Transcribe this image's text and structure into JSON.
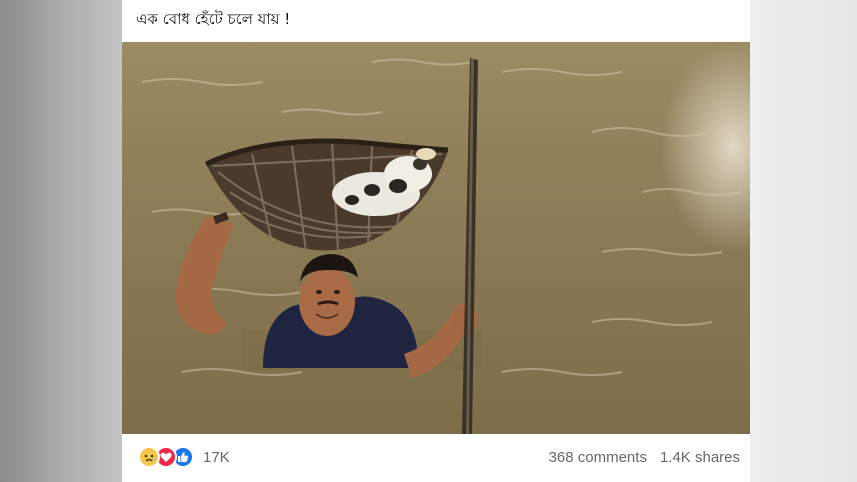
{
  "post": {
    "caption": "এক বোধ হেঁটে চলে যায় !",
    "photo": {
      "alt": "Man wading through floodwater carrying a basket of kittens on his head"
    },
    "reactions": {
      "icons": [
        "sad-reaction-icon",
        "love-reaction-icon",
        "like-reaction-icon"
      ],
      "count": "17K"
    },
    "comments_label": "368 comments",
    "shares_label": "1.4K shares"
  },
  "colors": {
    "water": "#8a7a55",
    "sad": "#f7c549",
    "love": "#f0284a",
    "like": "#1877f2",
    "meta_text": "#65676b"
  }
}
